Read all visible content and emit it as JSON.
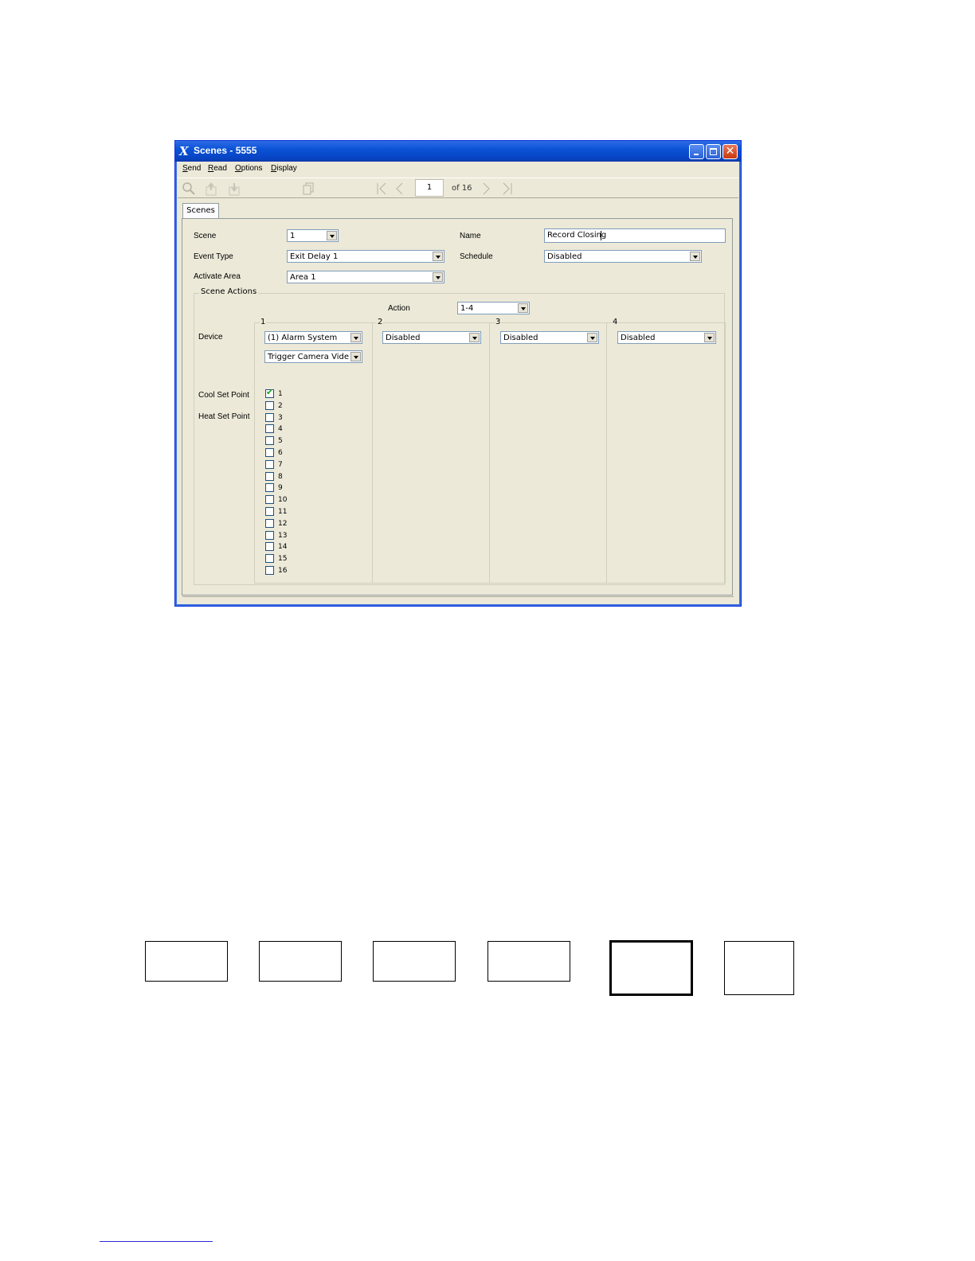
{
  "window": {
    "title": "Scenes - 5555"
  },
  "menu": [
    {
      "label_u": "S",
      "label_rest": "end"
    },
    {
      "label_u": "R",
      "label_rest": "ead"
    },
    {
      "label_u": "O",
      "label_rest": "ptions"
    },
    {
      "label_u": "D",
      "label_rest": "isplay"
    }
  ],
  "toolbar": {
    "icons": [
      "search-icon",
      "upload-icon",
      "download-icon",
      "copy-icon",
      "first-page-icon",
      "prev-page-icon",
      "next-page-icon",
      "last-page-icon"
    ],
    "page_value": "1",
    "page_of": "of 16"
  },
  "tab": {
    "label": "Scenes"
  },
  "form": {
    "scene_label": "Scene",
    "scene_value": "1",
    "event_type_label": "Event Type",
    "event_type_value": "Exit Delay 1",
    "activate_area_label": "Activate Area",
    "activate_area_value": "Area 1",
    "name_label": "Name",
    "name_value": "Record Closing",
    "schedule_label": "Schedule",
    "schedule_value": "Disabled"
  },
  "scene_actions": {
    "group_label": "Scene Actions",
    "action_label": "Action",
    "action_value": "1-4",
    "device_label": "Device",
    "cool_set_point_label": "Cool Set Point",
    "heat_set_point_label": "Heat Set Point",
    "columns": [
      {
        "number": "1",
        "device": "(1) Alarm System",
        "sub": "Trigger Camera Video C"
      },
      {
        "number": "2",
        "device": "Disabled"
      },
      {
        "number": "3",
        "device": "Disabled"
      },
      {
        "number": "4",
        "device": "Disabled"
      }
    ],
    "checkboxes": [
      {
        "label": "1",
        "checked": true
      },
      {
        "label": "2",
        "checked": false
      },
      {
        "label": "3",
        "checked": false
      },
      {
        "label": "4",
        "checked": false
      },
      {
        "label": "5",
        "checked": false
      },
      {
        "label": "6",
        "checked": false
      },
      {
        "label": "7",
        "checked": false
      },
      {
        "label": "8",
        "checked": false
      },
      {
        "label": "9",
        "checked": false
      },
      {
        "label": "10",
        "checked": false
      },
      {
        "label": "11",
        "checked": false
      },
      {
        "label": "12",
        "checked": false
      },
      {
        "label": "13",
        "checked": false
      },
      {
        "label": "14",
        "checked": false
      },
      {
        "label": "15",
        "checked": false
      },
      {
        "label": "16",
        "checked": false
      }
    ]
  },
  "colors": {
    "titlebar": "#0a53d6",
    "window_bg": "#ece9d8",
    "close_button": "#c9380d",
    "footer_rule": "#2b2bd6"
  }
}
